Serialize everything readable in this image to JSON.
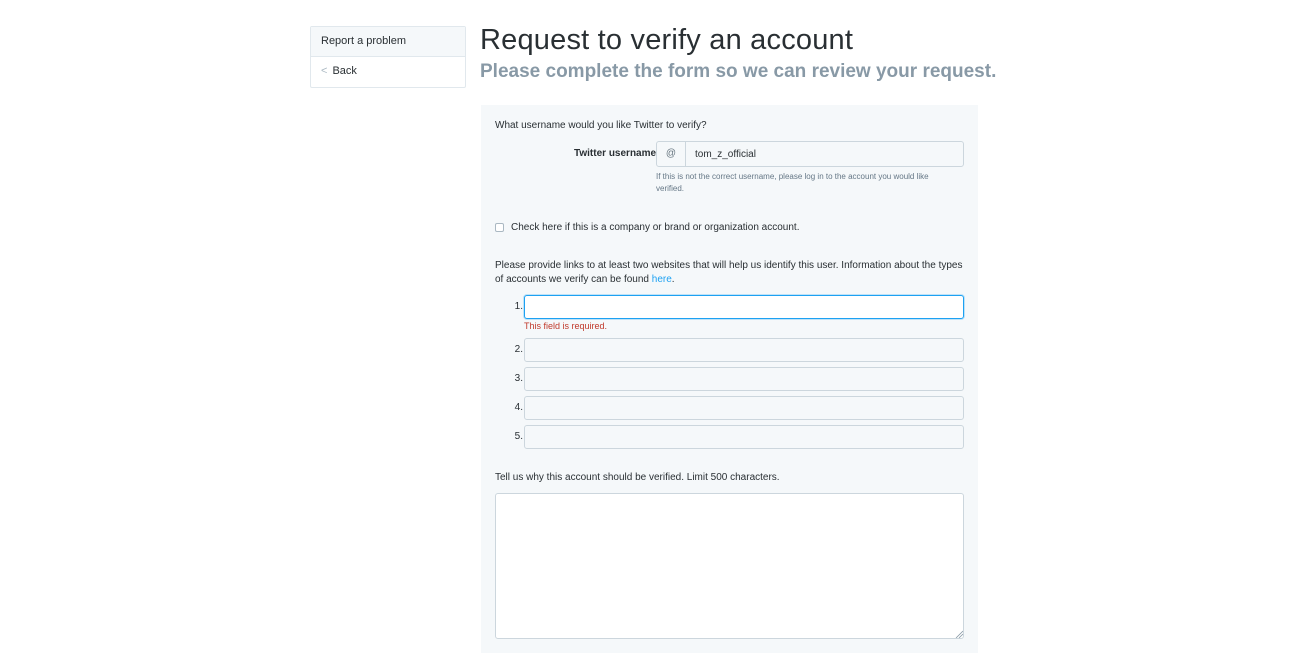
{
  "sidebar": {
    "title": "Report a problem",
    "back_chevron": "<",
    "back_label": "Back"
  },
  "header": {
    "title": "Request to verify an account",
    "subtitle": "Please complete the form so we can review your request."
  },
  "form": {
    "username_question": "What username would you like Twitter to verify?",
    "username_label": "Twitter username",
    "username_prefix": "@",
    "username_value": "tom_z_official",
    "username_help": "If this is not the correct username, please log in to the account you would like verified.",
    "company_checkbox_label": "Check here if this is a company or brand or organization account.",
    "company_checkbox_checked": false,
    "links_intro": "Please provide links to at least two websites that will help us identify this user. Information about the types of accounts we verify can be found ",
    "links_intro_link": "here",
    "links_intro_end": ".",
    "url_fields": [
      {
        "number": "1.",
        "value": ""
      },
      {
        "number": "2.",
        "value": ""
      },
      {
        "number": "3.",
        "value": ""
      },
      {
        "number": "4.",
        "value": ""
      },
      {
        "number": "5.",
        "value": ""
      }
    ],
    "url_error": "This field is required.",
    "reason_label": "Tell us why this account should be verified. Limit 500 characters.",
    "reason_value": ""
  },
  "icons": {
    "back": "chevron-left-icon",
    "resize": "resize-handle-icon"
  },
  "colors": {
    "link": "#1da1f2",
    "error": "#c0392b",
    "panel_bg": "#f5f8fa"
  }
}
